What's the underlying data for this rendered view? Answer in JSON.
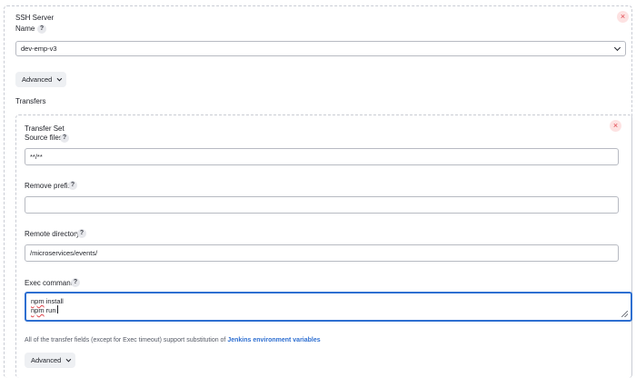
{
  "ssh_server": {
    "heading": "SSH Server",
    "name_label": "Name",
    "name_help": "?",
    "name_value": "dev-emp-v3",
    "close_symbol": "×",
    "advanced_label": "Advanced"
  },
  "transfers": {
    "label": "Transfers"
  },
  "transfer_set": {
    "heading": "Transfer Set",
    "close_symbol": "×",
    "source_files": {
      "label": "Source files",
      "help": "?",
      "value": "**/**"
    },
    "remove_prefix": {
      "label": "Remove prefix",
      "help": "?",
      "value": ""
    },
    "remote_directory": {
      "label": "Remote directory",
      "help": "?",
      "value": "/microservices/events/"
    },
    "exec_command": {
      "label": "Exec command",
      "help": "?",
      "lines": [
        {
          "spell": "npm",
          "rest": " install"
        },
        {
          "spell": "npm",
          "rest": " run"
        }
      ]
    },
    "note_text": "All of the transfer fields (except for Exec timeout) support substitution of ",
    "note_link": "Jenkins environment variables",
    "advanced_label": "Advanced"
  },
  "colors": {
    "accent": "#2e6fd1",
    "close_bg": "#fde2e2",
    "close_fg": "#e0444b",
    "border": "#b7bac2"
  }
}
